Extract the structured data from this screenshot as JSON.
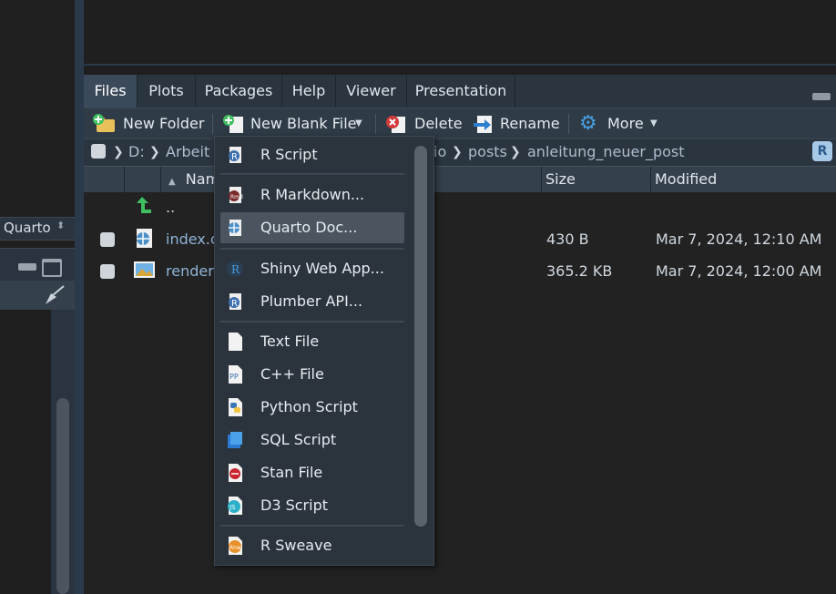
{
  "left_pane": {
    "quarto_label": "Quarto"
  },
  "tabs": [
    {
      "label": "Files",
      "active": true
    },
    {
      "label": "Plots",
      "active": false
    },
    {
      "label": "Packages",
      "active": false
    },
    {
      "label": "Help",
      "active": false
    },
    {
      "label": "Viewer",
      "active": false
    },
    {
      "label": "Presentation",
      "active": false
    }
  ],
  "toolbar": {
    "new_folder": "New Folder",
    "new_blank_file": "New Blank File",
    "delete": "Delete",
    "rename": "Rename",
    "more": "More"
  },
  "path": {
    "crumb_1": "D:",
    "crumb_2": "Arbeit",
    "crumb_partial": "io",
    "crumb_3": "posts",
    "crumb_4": "anleitung_neuer_post"
  },
  "list_header": {
    "name": "Nam",
    "size": "Size",
    "modified": "Modified"
  },
  "files": [
    {
      "name": "..",
      "size": "",
      "modified": ""
    },
    {
      "name": "index.c",
      "size": "430 B",
      "modified": "Mar 7, 2024, 12:10 AM"
    },
    {
      "name": "render",
      "size": "365.2 KB",
      "modified": "Mar 7, 2024, 12:00 AM"
    }
  ],
  "menu": {
    "items": [
      {
        "label": "R Script",
        "icon": "r-script-icon"
      },
      {
        "label": "R Markdown...",
        "icon": "r-markdown-icon"
      },
      {
        "label": "Quarto Doc...",
        "icon": "quarto-icon",
        "highlighted": true
      },
      {
        "label": "Shiny Web App...",
        "icon": "shiny-icon"
      },
      {
        "label": "Plumber API...",
        "icon": "plumber-icon"
      },
      {
        "label": "Text File",
        "icon": "text-file-icon"
      },
      {
        "label": "C++ File",
        "icon": "cpp-file-icon"
      },
      {
        "label": "Python Script",
        "icon": "python-icon"
      },
      {
        "label": "SQL Script",
        "icon": "sql-icon"
      },
      {
        "label": "Stan File",
        "icon": "stan-icon"
      },
      {
        "label": "D3 Script",
        "icon": "d3-icon"
      },
      {
        "label": "R Sweave",
        "icon": "sweave-icon"
      }
    ]
  }
}
